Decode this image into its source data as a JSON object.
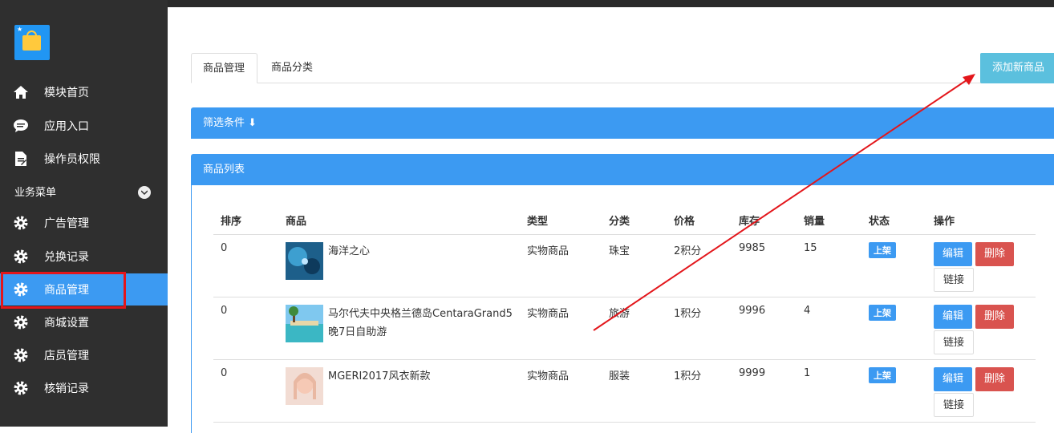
{
  "sidebar": {
    "items": [
      {
        "label": "模块首页",
        "icon": "home-icon"
      },
      {
        "label": "应用入口",
        "icon": "chat-icon"
      },
      {
        "label": "操作员权限",
        "icon": "document-icon"
      }
    ],
    "section_label": "业务菜单",
    "business_items": [
      {
        "label": "广告管理",
        "icon": "gear-icon"
      },
      {
        "label": "兑换记录",
        "icon": "gear-icon"
      },
      {
        "label": "商品管理",
        "icon": "gear-icon"
      },
      {
        "label": "商城设置",
        "icon": "gear-icon"
      },
      {
        "label": "店员管理",
        "icon": "gear-icon"
      },
      {
        "label": "核销记录",
        "icon": "gear-icon"
      }
    ]
  },
  "tabs": [
    {
      "label": "商品管理"
    },
    {
      "label": "商品分类"
    }
  ],
  "add_button": "添加新商品",
  "filter_panel": {
    "title": "筛选条件 ⬇"
  },
  "list_panel": {
    "title": "商品列表"
  },
  "table": {
    "headers": [
      "排序",
      "商品",
      "类型",
      "分类",
      "价格",
      "库存",
      "销量",
      "状态",
      "操作"
    ],
    "rows": [
      {
        "order": "0",
        "name": "海洋之心",
        "type": "实物商品",
        "category": "珠宝",
        "price": "2积分",
        "stock": "9985",
        "sales": "15",
        "status": "上架"
      },
      {
        "order": "0",
        "name": "马尔代夫中央格兰德岛CentaraGrand5晚7日自助游",
        "type": "实物商品",
        "category": "旅游",
        "price": "1积分",
        "stock": "9996",
        "sales": "4",
        "status": "上架"
      },
      {
        "order": "0",
        "name": "MGERI2017风衣新款",
        "type": "实物商品",
        "category": "服装",
        "price": "1积分",
        "stock": "9999",
        "sales": "1",
        "status": "上架"
      }
    ],
    "actions": {
      "edit": "编辑",
      "delete": "删除",
      "link": "链接"
    }
  },
  "colors": {
    "sidebar": "#2f2f2f",
    "accent": "#3c9af2",
    "danger": "#d9534f",
    "info": "#5bc0de",
    "annotation": "#e3161b"
  }
}
